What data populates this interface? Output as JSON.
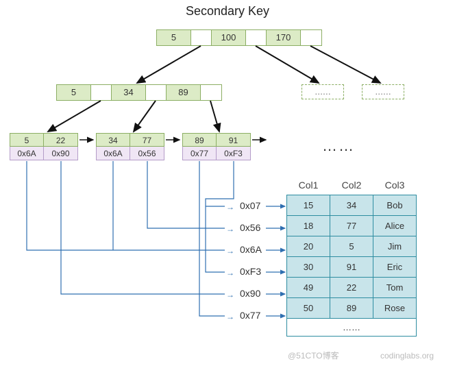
{
  "title": "Secondary Key",
  "root": {
    "keys": [
      "5",
      "100",
      "170"
    ]
  },
  "level1": {
    "keys": [
      "5",
      "34",
      "89"
    ]
  },
  "phantoms": {
    "dots": "......"
  },
  "leaves": [
    {
      "keys": [
        "5",
        "22"
      ],
      "addrs": [
        "0x6A",
        "0x90"
      ]
    },
    {
      "keys": [
        "34",
        "77"
      ],
      "addrs": [
        "0x6A",
        "0x56"
      ]
    },
    {
      "keys": [
        "89",
        "91"
      ],
      "addrs": [
        "0x77",
        "0xF3"
      ]
    }
  ],
  "leaf_dots": "……",
  "addr_labels": [
    "0x07",
    "0x56",
    "0x6A",
    "0xF3",
    "0x90",
    "0x77"
  ],
  "table": {
    "headers": [
      "Col1",
      "Col2",
      "Col3"
    ],
    "rows": [
      [
        "15",
        "34",
        "Bob"
      ],
      [
        "18",
        "77",
        "Alice"
      ],
      [
        "20",
        "5",
        "Jim"
      ],
      [
        "30",
        "91",
        "Eric"
      ],
      [
        "49",
        "22",
        "Tom"
      ],
      [
        "50",
        "89",
        "Rose"
      ]
    ],
    "more": "……"
  },
  "watermark": {
    "left": "@51CTO博客",
    "right": "codinglabs.org"
  },
  "chart_data": {
    "type": "table",
    "title": "Secondary Key B+Tree index over Col2 with leaf pointers to primary rows",
    "btree": {
      "root": {
        "keys": [
          5,
          100,
          170
        ]
      },
      "level1": {
        "keys": [
          5,
          34,
          89
        ]
      },
      "leaves": [
        {
          "keys": [
            5,
            22
          ],
          "ptrs": [
            "0x6A",
            "0x90"
          ]
        },
        {
          "keys": [
            34,
            77
          ],
          "ptrs": [
            "0x6A",
            "0x56"
          ]
        },
        {
          "keys": [
            89,
            91
          ],
          "ptrs": [
            "0x77",
            "0xF3"
          ]
        }
      ]
    },
    "address_list": [
      "0x07",
      "0x56",
      "0x6A",
      "0xF3",
      "0x90",
      "0x77"
    ],
    "primary_table": {
      "columns": [
        "Col1",
        "Col2",
        "Col3"
      ],
      "rows": [
        [
          15,
          34,
          "Bob"
        ],
        [
          18,
          77,
          "Alice"
        ],
        [
          20,
          5,
          "Jim"
        ],
        [
          30,
          91,
          "Eric"
        ],
        [
          49,
          22,
          "Tom"
        ],
        [
          50,
          89,
          "Rose"
        ]
      ]
    }
  }
}
